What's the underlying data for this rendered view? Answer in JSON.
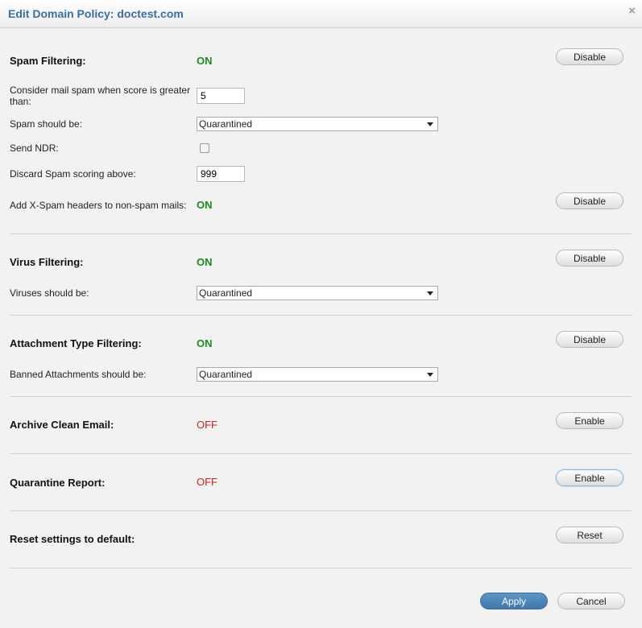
{
  "dialog": {
    "title": "Edit Domain Policy: doctest.com",
    "close_glyph": "×"
  },
  "spam": {
    "title": "Spam Filtering:",
    "status": "ON",
    "button": "Disable",
    "score_label": "Consider mail spam when score is greater than:",
    "score_value": "5",
    "action_label": "Spam should be:",
    "action_value": "Quarantined",
    "ndr_label": "Send NDR:",
    "ndr_checked": false,
    "discard_label": "Discard Spam scoring above:",
    "discard_value": "999",
    "xspam_label": "Add X-Spam headers to non-spam mails:",
    "xspam_status": "ON",
    "xspam_button": "Disable"
  },
  "virus": {
    "title": "Virus Filtering:",
    "status": "ON",
    "button": "Disable",
    "action_label": "Viruses should be:",
    "action_value": "Quarantined"
  },
  "attachment": {
    "title": "Attachment Type Filtering:",
    "status": "ON",
    "button": "Disable",
    "action_label": "Banned Attachments should be:",
    "action_value": "Quarantined"
  },
  "archive": {
    "title": "Archive Clean Email:",
    "status": "OFF",
    "button": "Enable"
  },
  "quarantine_report": {
    "title": "Quarantine Report:",
    "status": "OFF",
    "button": "Enable"
  },
  "reset": {
    "title": "Reset settings to default:",
    "button": "Reset"
  },
  "footer": {
    "apply": "Apply",
    "cancel": "Cancel"
  },
  "colors": {
    "on": "#1f8a1f",
    "off": "#cc2222",
    "title": "#3a6ea5",
    "primary_button": "#4a82b8"
  }
}
